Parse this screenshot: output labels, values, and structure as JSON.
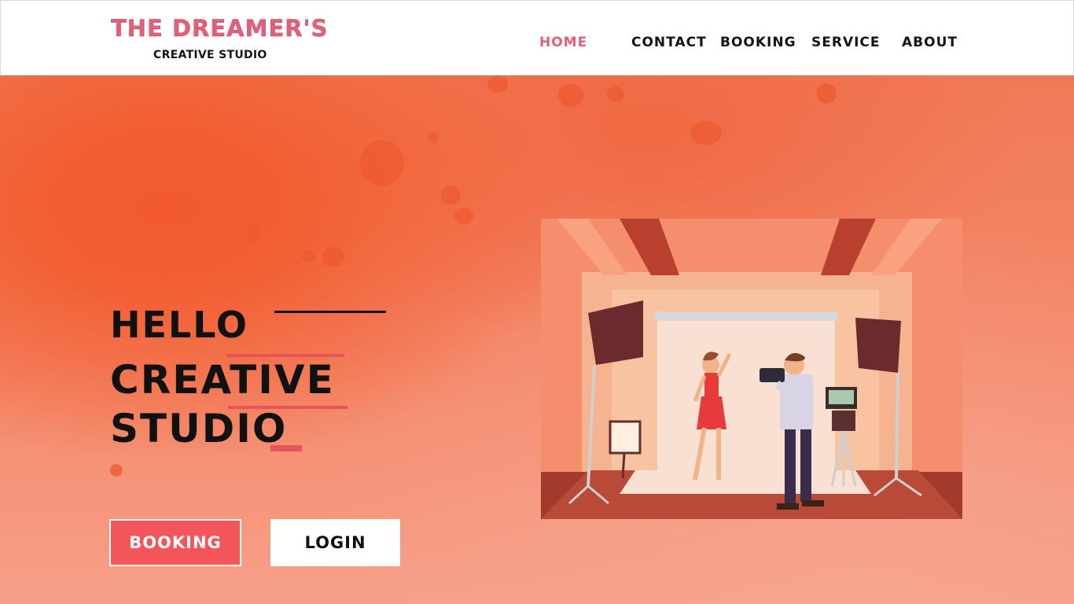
{
  "logo": {
    "title": "THE DREAMER'S",
    "subtitle": "CREATIVE STUDIO"
  },
  "nav": {
    "home": "HOME",
    "contact": "CONTACT",
    "booking": "BOOKING",
    "service": "SERVICE",
    "about": "ABOUT"
  },
  "hero": {
    "hello": "HELLO",
    "line1": "CREATIVE",
    "line2": "STUDIO"
  },
  "buttons": {
    "booking": "BOOKING",
    "login": "LOGIN"
  },
  "colors": {
    "brand": "#e0607a",
    "background": "#f3876a",
    "booking_button": "#f4555a",
    "accent": "#e8545c"
  }
}
